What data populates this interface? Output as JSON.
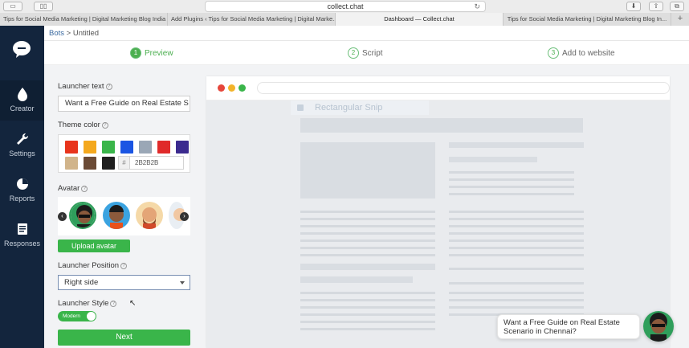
{
  "browser": {
    "url": "collect.chat",
    "tabs": [
      {
        "label": "Tips for Social Media Marketing | Digital Marketing Blog India",
        "active": false
      },
      {
        "label": "Add Plugins ‹ Tips for Social Media Marketing | Digital Marke...",
        "active": false
      },
      {
        "label": "Dashboard — Collect.chat",
        "active": true
      },
      {
        "label": "Tips for Social Media Marketing | Digital Marketing Blog In...",
        "active": false
      }
    ]
  },
  "sidebar": {
    "items": [
      {
        "label": "Creator",
        "icon": "drop-icon"
      },
      {
        "label": "Settings",
        "icon": "wrench-icon"
      },
      {
        "label": "Reports",
        "icon": "pie-chart-icon"
      },
      {
        "label": "Responses",
        "icon": "list-icon"
      }
    ]
  },
  "breadcrumb": {
    "link": "Bots",
    "separator": ">",
    "current": "Untitled"
  },
  "steps": [
    {
      "num": "1",
      "label": "Preview",
      "active": true
    },
    {
      "num": "2",
      "label": "Script",
      "active": false
    },
    {
      "num": "3",
      "label": "Add to website",
      "active": false
    }
  ],
  "config": {
    "launcher_text_label": "Launcher text",
    "launcher_text_value": "Want a Free Guide on Real Estate S",
    "theme_color_label": "Theme color",
    "theme_colors": [
      "#e8341c",
      "#f4a81d",
      "#3ab54a",
      "#1a55e3",
      "#9aa7b6",
      "#e02a2a",
      "#3c2b8f",
      "#d1b48a",
      "#6b4a35",
      "#1f1f1f"
    ],
    "hex_symbol": "#",
    "hex_value": "2B2B2B",
    "avatar_label": "Avatar",
    "upload_avatar": "Upload avatar",
    "launcher_position_label": "Launcher Position",
    "launcher_position_value": "Right side",
    "launcher_style_label": "Launcher Style",
    "launcher_style_value": "Modern",
    "next_button": "Next"
  },
  "preview": {
    "snip_label": "Rectangular Snip",
    "bubble_text": "Want a Free Guide on Real Estate Scenario in Chennai?"
  }
}
